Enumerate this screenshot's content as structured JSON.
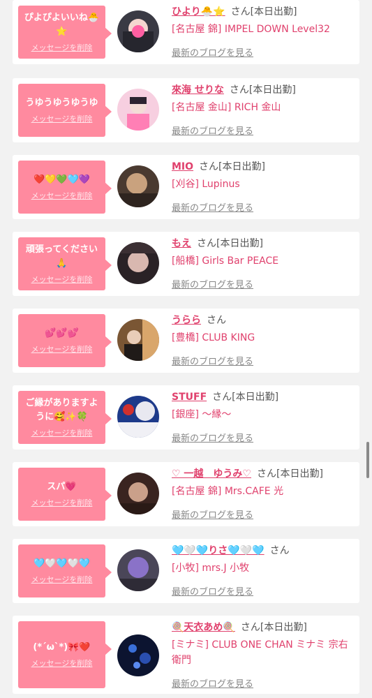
{
  "delete_label": "メッセージを削除",
  "blog_label": "最新のブログを見る",
  "san_label": "さん",
  "accent_color": "#e0416d",
  "bubble_color": "#ff8a9f",
  "items": [
    {
      "message": "ぴよぴよいいね🐣⭐",
      "name": "ひより🐣⭐",
      "status": "[本日出勤]",
      "shop": "[名古屋 錦] IMPEL DOWN Level32"
    },
    {
      "message": "うゆうゆうゆうゆ",
      "name": "來海 せりな",
      "status": "[本日出勤]",
      "shop": "[名古屋 金山] RICH 金山"
    },
    {
      "message": "❤️💛💚🩵💜",
      "name": "MIO",
      "status": "[本日出勤]",
      "shop": "[刈谷] Lupinus"
    },
    {
      "message": "頑張ってください🙏",
      "name": "もえ",
      "status": "[本日出勤]",
      "shop": "[船橋] Girls Bar PEACE"
    },
    {
      "message": "💕💕💕",
      "name": "うらら",
      "status": "",
      "shop": "[豊橋] CLUB KING"
    },
    {
      "message": "ご縁がありますように🥰✨🍀",
      "name": "STUFF",
      "status": "[本日出勤]",
      "shop": "[銀座] 〜縁〜"
    },
    {
      "message": "スパ💗",
      "name": "♡ 一越　ゆうみ♡",
      "status": "[本日出勤]",
      "shop": "[名古屋 錦] Mrs.CAFE 光"
    },
    {
      "message": "🩵🤍🩵🤍🩵",
      "name": "🩵🤍🩵りさ🩵🤍🩵",
      "status": "",
      "shop": "[小牧] mrs.J 小牧"
    },
    {
      "message": "(*´ω`*)🎀❤️",
      "name": "🍭天衣あめ🍭",
      "status": "[本日出勤]",
      "shop": "[ミナミ] CLUB ONE CHAN ミナミ 宗右衛門"
    }
  ]
}
